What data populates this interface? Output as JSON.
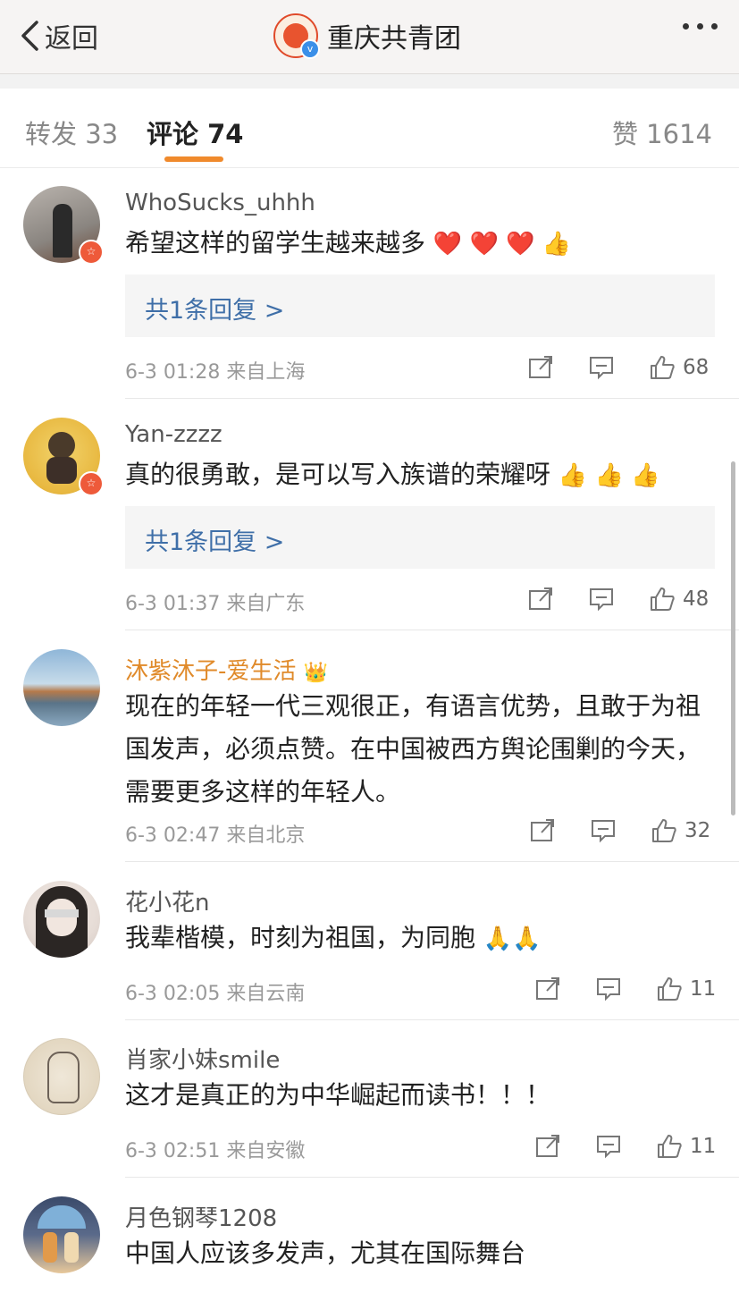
{
  "header": {
    "back_label": "返回",
    "title": "重庆共青团",
    "verified_mark": "v"
  },
  "tabs": [
    {
      "label": "转发 33"
    },
    {
      "label": "评论 74"
    },
    {
      "label": "赞 1614"
    }
  ],
  "comments": [
    {
      "user": "WhoSucks_uhhh",
      "text": "希望这样的留学生越来越多",
      "emoji": "❤️ ❤️ ❤️ 👍",
      "reply": "共1条回复 >",
      "meta": "6-3 01:28  来自上海",
      "likes": "68",
      "badge": "☆"
    },
    {
      "user": "Yan-zzzz",
      "text": "真的很勇敢，是可以写入族谱的荣耀呀",
      "emoji": "👍 👍 👍",
      "reply": "共1条回复 >",
      "meta": "6-3 01:37  来自广东",
      "likes": "48",
      "badge": "☆"
    },
    {
      "user": "沐紫沐子-爱生活",
      "user_icon": "👑",
      "text": "现在的年轻一代三观很正，有语言优势，且敢于为祖国发声，必须点赞。在中国被西方舆论围剿的今天，需要更多这样的年轻人。",
      "meta": "6-3 02:47  来自北京",
      "likes": "32"
    },
    {
      "user": "花小花n",
      "text": "我辈楷模，时刻为祖国，为同胞",
      "emoji": "🙏🙏",
      "meta": "6-3 02:05  来自云南",
      "likes": "11"
    },
    {
      "user": "肖家小妹smile",
      "text": "这才是真正的为中华崛起而读书！！！",
      "meta": "6-3 02:51  来自安徽",
      "likes": "11"
    },
    {
      "user": "月色钢琴1208",
      "text": "中国人应该多发声，尤其在国际舞台"
    }
  ],
  "colors": {
    "accent": "#f08a2c",
    "link": "#3f6fa8",
    "gold_name": "#e08a2a"
  }
}
